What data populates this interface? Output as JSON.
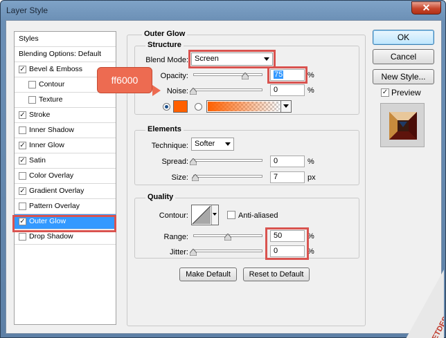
{
  "window": {
    "title": "Layer Style",
    "close_glyph": "✕"
  },
  "styles_list": {
    "items": [
      {
        "label": "Styles",
        "kind": "header"
      },
      {
        "label": "Blending Options: Default",
        "kind": "header"
      },
      {
        "label": "Bevel & Emboss",
        "checked": true,
        "indent": 0
      },
      {
        "label": "Contour",
        "checked": false,
        "indent": 1
      },
      {
        "label": "Texture",
        "checked": false,
        "indent": 1
      },
      {
        "label": "Stroke",
        "checked": true,
        "indent": 0
      },
      {
        "label": "Inner Shadow",
        "checked": false,
        "indent": 0
      },
      {
        "label": "Inner Glow",
        "checked": true,
        "indent": 0
      },
      {
        "label": "Satin",
        "checked": true,
        "indent": 0
      },
      {
        "label": "Color Overlay",
        "checked": false,
        "indent": 0
      },
      {
        "label": "Gradient Overlay",
        "checked": true,
        "indent": 0
      },
      {
        "label": "Pattern Overlay",
        "checked": false,
        "indent": 0
      },
      {
        "label": "Outer Glow",
        "checked": true,
        "indent": 0,
        "selected": true
      },
      {
        "label": "Drop Shadow",
        "checked": false,
        "indent": 0
      }
    ]
  },
  "outer_glow": {
    "title": "Outer Glow",
    "structure": {
      "title": "Structure",
      "blend_mode_label": "Blend Mode:",
      "blend_mode_value": "Screen",
      "opacity_label": "Opacity:",
      "opacity_value": "75",
      "opacity_level": 0.75,
      "noise_label": "Noise:",
      "noise_value": "0",
      "noise_level": 0,
      "glow_color": "#ff6000",
      "callout_text": "ff6000"
    },
    "elements": {
      "title": "Elements",
      "technique_label": "Technique:",
      "technique_value": "Softer",
      "spread_label": "Spread:",
      "spread_value": "0",
      "spread_level": 0,
      "size_label": "Size:",
      "size_value": "7",
      "size_level": 0.03
    },
    "quality": {
      "title": "Quality",
      "contour_label": "Contour:",
      "anti_aliased_label": "Anti-aliased",
      "anti_aliased": false,
      "range_label": "Range:",
      "range_value": "50",
      "range_level": 0.5,
      "jitter_label": "Jitter:",
      "jitter_value": "0",
      "jitter_level": 0
    },
    "percent": "%",
    "px": "px"
  },
  "buttons": {
    "make_default": "Make Default",
    "reset_default": "Reset to Default",
    "ok": "OK",
    "cancel": "Cancel",
    "new_style": "New Style...",
    "preview": "Preview"
  },
  "watermark": "VIETDESIGNER.NET",
  "colors": {
    "accent_red": "#d9534f",
    "selection": "#3399ff",
    "callout": "#ed6b51"
  }
}
